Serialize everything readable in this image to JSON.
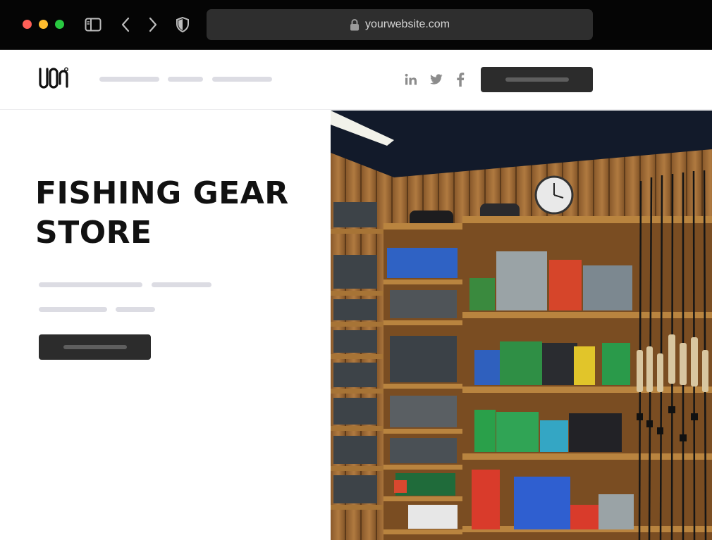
{
  "browser": {
    "url": "yourwebsite.com",
    "icons": [
      "sidebar-icon",
      "back-arrow-icon",
      "forward-arrow-icon",
      "shield-icon",
      "lock-icon"
    ]
  },
  "header": {
    "logo_icon": "logo-icon",
    "social_icons": [
      "linkedin-icon",
      "twitter-icon",
      "facebook-icon"
    ]
  },
  "hero": {
    "title_line1": "FISHING GEAR",
    "title_line2": "STORE",
    "image": "fishing-gear-store-shelves-photo"
  },
  "colors": {
    "browser_bar": "#050505",
    "address_bar": "#2e2e2e",
    "button_dark": "#2c2c2c",
    "placeholder_line": "#dcdce3",
    "title_text": "#111111"
  }
}
